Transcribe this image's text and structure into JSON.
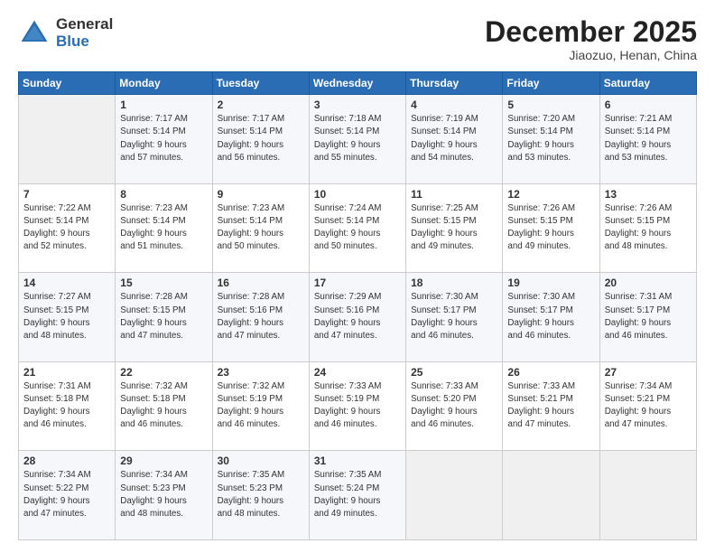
{
  "logo": {
    "general": "General",
    "blue": "Blue"
  },
  "title": "December 2025",
  "subtitle": "Jiaozuo, Henan, China",
  "headers": [
    "Sunday",
    "Monday",
    "Tuesday",
    "Wednesday",
    "Thursday",
    "Friday",
    "Saturday"
  ],
  "weeks": [
    [
      {
        "day": "",
        "info": ""
      },
      {
        "day": "1",
        "info": "Sunrise: 7:17 AM\nSunset: 5:14 PM\nDaylight: 9 hours\nand 57 minutes."
      },
      {
        "day": "2",
        "info": "Sunrise: 7:17 AM\nSunset: 5:14 PM\nDaylight: 9 hours\nand 56 minutes."
      },
      {
        "day": "3",
        "info": "Sunrise: 7:18 AM\nSunset: 5:14 PM\nDaylight: 9 hours\nand 55 minutes."
      },
      {
        "day": "4",
        "info": "Sunrise: 7:19 AM\nSunset: 5:14 PM\nDaylight: 9 hours\nand 54 minutes."
      },
      {
        "day": "5",
        "info": "Sunrise: 7:20 AM\nSunset: 5:14 PM\nDaylight: 9 hours\nand 53 minutes."
      },
      {
        "day": "6",
        "info": "Sunrise: 7:21 AM\nSunset: 5:14 PM\nDaylight: 9 hours\nand 53 minutes."
      }
    ],
    [
      {
        "day": "7",
        "info": "Sunrise: 7:22 AM\nSunset: 5:14 PM\nDaylight: 9 hours\nand 52 minutes."
      },
      {
        "day": "8",
        "info": "Sunrise: 7:23 AM\nSunset: 5:14 PM\nDaylight: 9 hours\nand 51 minutes."
      },
      {
        "day": "9",
        "info": "Sunrise: 7:23 AM\nSunset: 5:14 PM\nDaylight: 9 hours\nand 50 minutes."
      },
      {
        "day": "10",
        "info": "Sunrise: 7:24 AM\nSunset: 5:14 PM\nDaylight: 9 hours\nand 50 minutes."
      },
      {
        "day": "11",
        "info": "Sunrise: 7:25 AM\nSunset: 5:15 PM\nDaylight: 9 hours\nand 49 minutes."
      },
      {
        "day": "12",
        "info": "Sunrise: 7:26 AM\nSunset: 5:15 PM\nDaylight: 9 hours\nand 49 minutes."
      },
      {
        "day": "13",
        "info": "Sunrise: 7:26 AM\nSunset: 5:15 PM\nDaylight: 9 hours\nand 48 minutes."
      }
    ],
    [
      {
        "day": "14",
        "info": "Sunrise: 7:27 AM\nSunset: 5:15 PM\nDaylight: 9 hours\nand 48 minutes."
      },
      {
        "day": "15",
        "info": "Sunrise: 7:28 AM\nSunset: 5:15 PM\nDaylight: 9 hours\nand 47 minutes."
      },
      {
        "day": "16",
        "info": "Sunrise: 7:28 AM\nSunset: 5:16 PM\nDaylight: 9 hours\nand 47 minutes."
      },
      {
        "day": "17",
        "info": "Sunrise: 7:29 AM\nSunset: 5:16 PM\nDaylight: 9 hours\nand 47 minutes."
      },
      {
        "day": "18",
        "info": "Sunrise: 7:30 AM\nSunset: 5:17 PM\nDaylight: 9 hours\nand 46 minutes."
      },
      {
        "day": "19",
        "info": "Sunrise: 7:30 AM\nSunset: 5:17 PM\nDaylight: 9 hours\nand 46 minutes."
      },
      {
        "day": "20",
        "info": "Sunrise: 7:31 AM\nSunset: 5:17 PM\nDaylight: 9 hours\nand 46 minutes."
      }
    ],
    [
      {
        "day": "21",
        "info": "Sunrise: 7:31 AM\nSunset: 5:18 PM\nDaylight: 9 hours\nand 46 minutes."
      },
      {
        "day": "22",
        "info": "Sunrise: 7:32 AM\nSunset: 5:18 PM\nDaylight: 9 hours\nand 46 minutes."
      },
      {
        "day": "23",
        "info": "Sunrise: 7:32 AM\nSunset: 5:19 PM\nDaylight: 9 hours\nand 46 minutes."
      },
      {
        "day": "24",
        "info": "Sunrise: 7:33 AM\nSunset: 5:19 PM\nDaylight: 9 hours\nand 46 minutes."
      },
      {
        "day": "25",
        "info": "Sunrise: 7:33 AM\nSunset: 5:20 PM\nDaylight: 9 hours\nand 46 minutes."
      },
      {
        "day": "26",
        "info": "Sunrise: 7:33 AM\nSunset: 5:21 PM\nDaylight: 9 hours\nand 47 minutes."
      },
      {
        "day": "27",
        "info": "Sunrise: 7:34 AM\nSunset: 5:21 PM\nDaylight: 9 hours\nand 47 minutes."
      }
    ],
    [
      {
        "day": "28",
        "info": "Sunrise: 7:34 AM\nSunset: 5:22 PM\nDaylight: 9 hours\nand 47 minutes."
      },
      {
        "day": "29",
        "info": "Sunrise: 7:34 AM\nSunset: 5:23 PM\nDaylight: 9 hours\nand 48 minutes."
      },
      {
        "day": "30",
        "info": "Sunrise: 7:35 AM\nSunset: 5:23 PM\nDaylight: 9 hours\nand 48 minutes."
      },
      {
        "day": "31",
        "info": "Sunrise: 7:35 AM\nSunset: 5:24 PM\nDaylight: 9 hours\nand 49 minutes."
      },
      {
        "day": "",
        "info": ""
      },
      {
        "day": "",
        "info": ""
      },
      {
        "day": "",
        "info": ""
      }
    ]
  ]
}
